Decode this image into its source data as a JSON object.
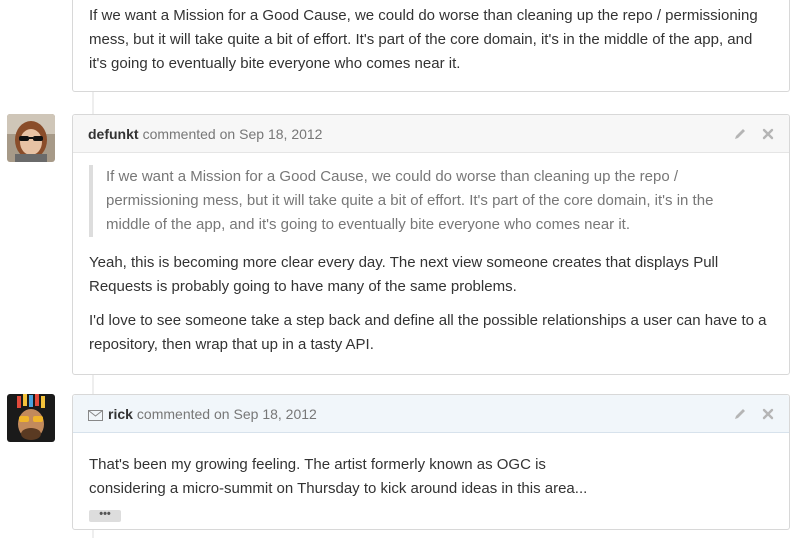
{
  "comments": [
    {
      "body": [
        "If we want a Mission for a Good Cause, we could do worse than cleaning up the repo / permissioning mess, but it will take quite a bit of effort. It's part of the core domain, it's in the middle of the app, and it's going to eventually bite everyone who comes near it."
      ]
    },
    {
      "author": "defunkt",
      "action": "commented on",
      "date": "Sep 18, 2012",
      "quote": "If we want a Mission for a Good Cause, we could do worse than cleaning up the repo / permissioning mess, but it will take quite a bit of effort. It's part of the core domain, it's in the middle of the app, and it's going to eventually bite everyone who comes near it.",
      "paragraphs": [
        "Yeah, this is becoming more clear every day. The next view someone creates that displays Pull Requests is probably going to have many of the same problems.",
        "I'd love to see someone take a step back and define all the possible relationships a user can have to a repository, then wrap that up in a tasty API."
      ]
    },
    {
      "author": "rick",
      "action": "commented on",
      "date": "Sep 18, 2012",
      "via_email_icon": "envelope-icon",
      "lines": [
        "That's been my growing feeling.  The artist formerly known as OGC is",
        "considering a micro-summit on Thursday to kick around ideas in this area..."
      ],
      "more_label": "•••"
    }
  ],
  "icons": {
    "edit": "pencil-icon",
    "delete": "close-icon"
  },
  "colors": {
    "header_bg": "#f7f7f7",
    "email_header_bg": "#f1f6fa",
    "border": "#d8d8d8",
    "quote_text": "#777777"
  }
}
